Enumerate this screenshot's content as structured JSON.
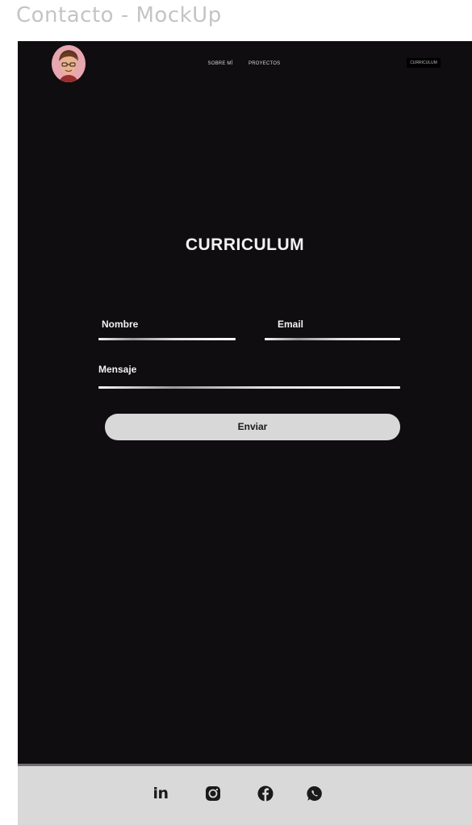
{
  "frame": {
    "title": "Contacto - MockUp"
  },
  "header": {
    "nav": [
      {
        "label": "SOBRE MÍ"
      },
      {
        "label": "PROYECTOS"
      }
    ],
    "cv_button": "CURRICULUM"
  },
  "main": {
    "title": "CURRICULUM",
    "form": {
      "name_label": "Nombre",
      "email_label": "Email",
      "message_label": "Mensaje",
      "submit_label": "Enviar"
    }
  },
  "footer": {
    "icons": [
      "linkedin-icon",
      "instagram-icon",
      "facebook-icon",
      "whatsapp-icon"
    ],
    "linkedin_text": "in"
  },
  "colors": {
    "background": "#0f0d0f",
    "footer": "#d9d9d9",
    "button": "#d8d8d8",
    "text": "#f2f2f2"
  }
}
